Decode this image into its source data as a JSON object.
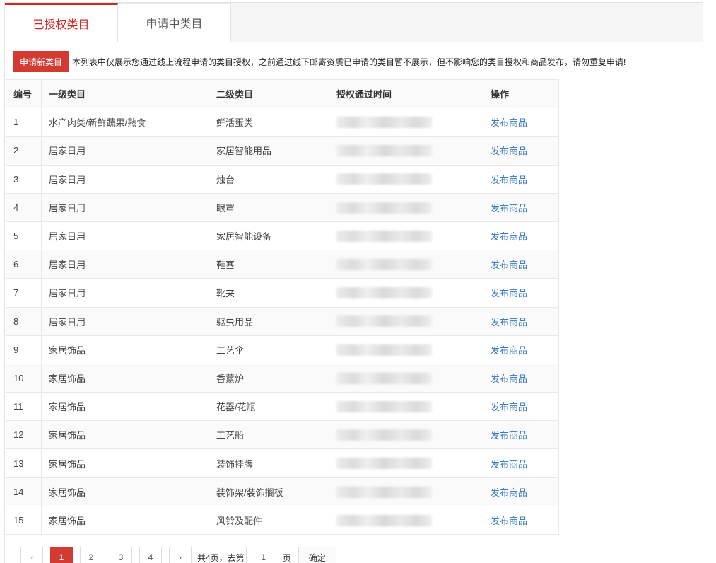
{
  "tabs": [
    {
      "label": "已授权类目",
      "active": true
    },
    {
      "label": "申请中类目",
      "active": false
    }
  ],
  "notice": {
    "button_label": "申请新类目",
    "text": "本列表中仅展示您通过线上流程申请的类目授权，之前通过线下邮寄资质已申请的类目暂不展示，但不影响您的类目授权和商品发布，请勿重复申请!"
  },
  "table": {
    "headers": [
      "编号",
      "一级类目",
      "二级类目",
      "授权通过时间",
      "操作"
    ],
    "action_label": "发布商品",
    "rows": [
      {
        "no": "1",
        "level1": "水产肉类/新鲜蔬果/熟食",
        "level2": "鲜活蛋类",
        "time": "",
        "action": "发布商品"
      },
      {
        "no": "2",
        "level1": "居家日用",
        "level2": "家居智能用品",
        "time": "",
        "action": "发布商品"
      },
      {
        "no": "3",
        "level1": "居家日用",
        "level2": "烛台",
        "time": "",
        "action": "发布商品"
      },
      {
        "no": "4",
        "level1": "居家日用",
        "level2": "眼罩",
        "time": "",
        "action": "发布商品"
      },
      {
        "no": "5",
        "level1": "居家日用",
        "level2": "家居智能设备",
        "time": "",
        "action": "发布商品"
      },
      {
        "no": "6",
        "level1": "居家日用",
        "level2": "鞋塞",
        "time": "",
        "action": "发布商品"
      },
      {
        "no": "7",
        "level1": "居家日用",
        "level2": "靴夹",
        "time": "",
        "action": "发布商品"
      },
      {
        "no": "8",
        "level1": "居家日用",
        "level2": "驱虫用品",
        "time": "",
        "action": "发布商品"
      },
      {
        "no": "9",
        "level1": "家居饰品",
        "level2": "工艺伞",
        "time": "",
        "action": "发布商品"
      },
      {
        "no": "10",
        "level1": "家居饰品",
        "level2": "香薰炉",
        "time": "",
        "action": "发布商品"
      },
      {
        "no": "11",
        "level1": "家居饰品",
        "level2": "花器/花瓶",
        "time": "",
        "action": "发布商品"
      },
      {
        "no": "12",
        "level1": "家居饰品",
        "level2": "工艺船",
        "time": "",
        "action": "发布商品"
      },
      {
        "no": "13",
        "level1": "家居饰品",
        "level2": "装饰挂牌",
        "time": "",
        "action": "发布商品"
      },
      {
        "no": "14",
        "level1": "家居饰品",
        "level2": "装饰架/装饰搁板",
        "time": "",
        "action": "发布商品"
      },
      {
        "no": "15",
        "level1": "家居饰品",
        "level2": "风铃及配件",
        "time": "",
        "action": "发布商品"
      }
    ]
  },
  "pagination": {
    "prev": "‹",
    "next": "›",
    "pages": [
      "1",
      "2",
      "3",
      "4"
    ],
    "current": "1",
    "total_text": "共4页，去第",
    "input_value": "1",
    "page_suffix": "页",
    "confirm_label": "确定"
  },
  "colors": {
    "accent": "#d33a31",
    "link": "#3a7cc6"
  }
}
